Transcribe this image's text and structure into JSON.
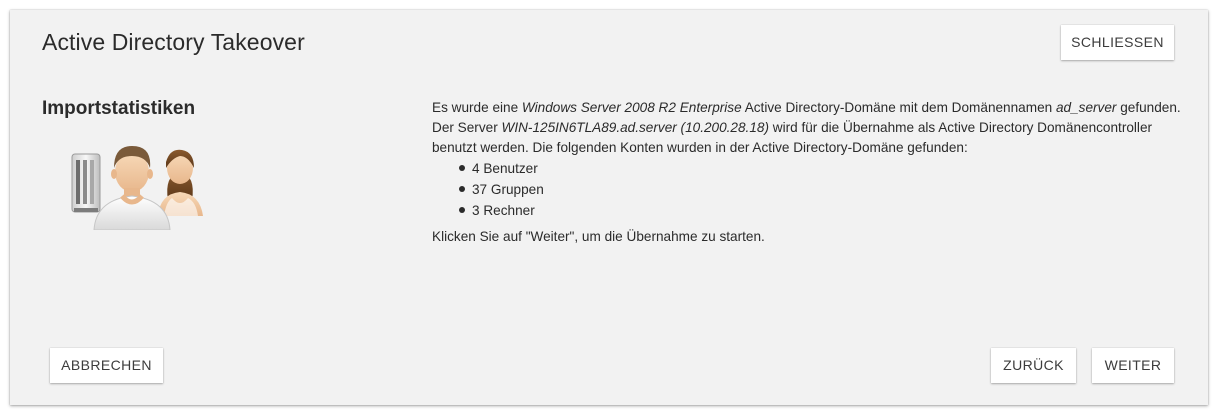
{
  "dialog": {
    "title": "Active Directory Takeover",
    "close_label": "SCHLIESSEN",
    "section_title": "Importstatistiken",
    "cancel_label": "ABBRECHEN",
    "back_label": "ZURÜCK",
    "next_label": "WEITER"
  },
  "message": {
    "p1_a": "Es wurde eine ",
    "os_name": "Windows Server 2008 R2 Enterprise",
    "p1_b": " Active Directory-Domäne mit dem Domänennamen ",
    "domain_name": "ad_server",
    "p1_c": " gefunden. Der Server ",
    "server_name": "WIN-125IN6TLA89.ad.server (10.200.28.18)",
    "p1_d": " wird für die Übernahme als Active Directory Domänencontroller benutzt werden. Die folgenden Konten wurden in der Active Directory-Domäne gefunden:",
    "stats": [
      "4 Benutzer",
      "37 Gruppen",
      "3 Rechner"
    ],
    "instruction": "Klicken Sie auf \"Weiter\", um die Übernahme zu starten."
  },
  "icons": {
    "illustration": "server-and-users-icon"
  },
  "colors": {
    "dialog_background": "#f2f2f2",
    "button_background": "#ffffff",
    "text": "#2b2b2b"
  }
}
